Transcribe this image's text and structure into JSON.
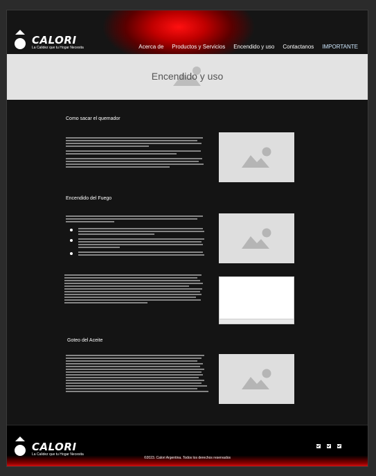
{
  "header": {
    "brand": "CALORI",
    "tagline": "La Calidez que tu Hogar Necesita",
    "nav": [
      {
        "label": "Acerca de"
      },
      {
        "label": "Productos y Servicios"
      },
      {
        "label": "Encendido y uso"
      },
      {
        "label": "Contactanos"
      },
      {
        "label": "IMPORTANTE"
      }
    ]
  },
  "banner": {
    "title": "Encendido y uso"
  },
  "sections": {
    "s1": {
      "heading": "Como sacar el quemador",
      "image_icon": "image-placeholder-icon"
    },
    "s2": {
      "heading": "Encendido del Fuego",
      "image_icon": "image-placeholder-icon"
    },
    "s3": {
      "heading": "Goteo del Aceite",
      "image_icon": "image-placeholder-icon"
    }
  },
  "footer": {
    "brand": "CALORI",
    "tagline": "La Calidez que tu Hogar Necesita",
    "copyright": "©2023. Calori Argentina. Todos los derechos reservados",
    "social_icons": [
      "checkbox-icon",
      "checkbox-icon",
      "checkbox-icon"
    ]
  },
  "colors": {
    "accent": "#ff1010",
    "background": "#141414",
    "banner": "#e3e3e3"
  }
}
